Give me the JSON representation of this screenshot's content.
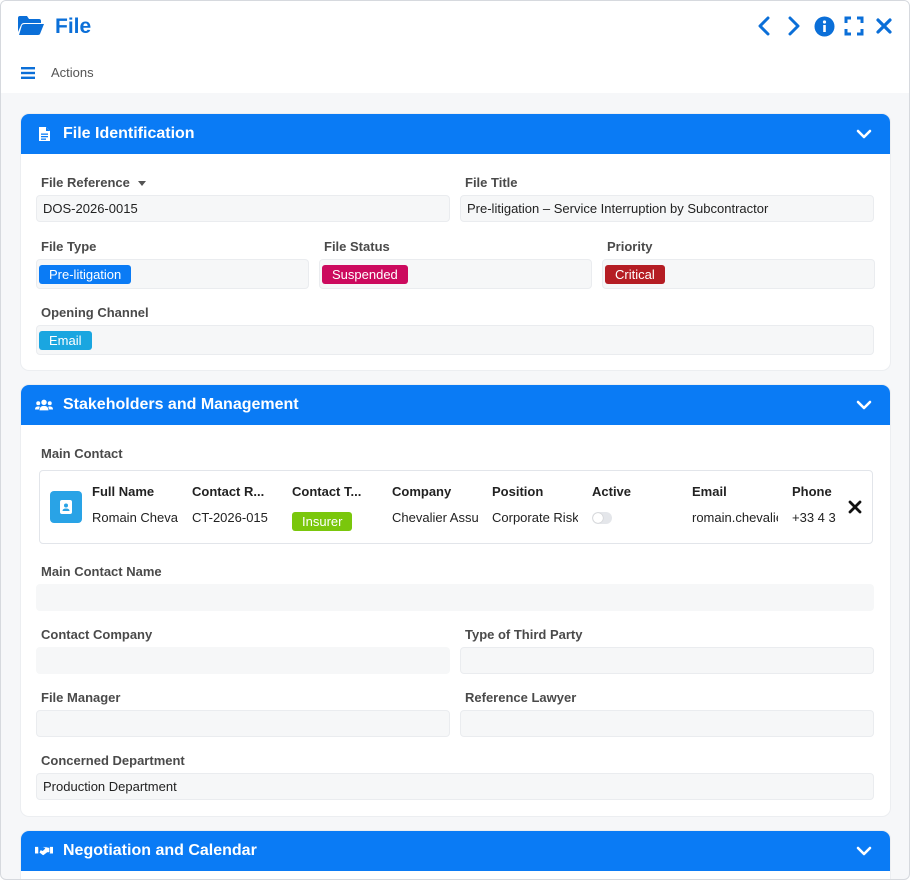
{
  "window": {
    "title": "File",
    "actions_label": "Actions"
  },
  "sections": {
    "identification": {
      "title": "File Identification",
      "file_reference_label": "File Reference",
      "file_reference_value": "DOS-2026-0015",
      "file_title_label": "File Title",
      "file_title_value": "Pre-litigation – Service Interruption by Subcontractor",
      "file_type_label": "File Type",
      "file_type_value": "Pre-litigation",
      "file_status_label": "File Status",
      "file_status_value": "Suspended",
      "priority_label": "Priority",
      "priority_value": "Critical",
      "opening_channel_label": "Opening Channel",
      "opening_channel_value": "Email"
    },
    "stakeholders": {
      "title": "Stakeholders and Management",
      "main_contact_label": "Main Contact",
      "contact_columns": [
        "Full Name",
        "Contact R...",
        "Contact T...",
        "Company",
        "Position",
        "Active",
        "Email",
        "Phone"
      ],
      "contact_row": {
        "full_name": "Romain Chevalier",
        "contact_ref": "CT-2026-015",
        "contact_type": "Insurer",
        "company": "Chevalier Assurances",
        "position": "Corporate Risk Manager",
        "email": "romain.chevalier@",
        "phone": "+33 4 3"
      },
      "main_contact_name_label": "Main Contact Name",
      "contact_company_label": "Contact Company",
      "third_party_label": "Type of Third Party",
      "file_manager_label": "File Manager",
      "reference_lawyer_label": "Reference Lawyer",
      "concerned_department_label": "Concerned Department",
      "concerned_department_value": "Production Department"
    },
    "negotiation": {
      "title": "Negotiation and Calendar"
    }
  },
  "colors": {
    "accent": "#0a7bf5",
    "title_blue": "#0b6fd8",
    "pill_pre_litigation": "#0a7bf5",
    "pill_suspended": "#cc0a5e",
    "pill_critical": "#b51d24",
    "pill_email": "#1aa6e0",
    "pill_insurer": "#7ac70c"
  },
  "icons": {
    "title": "folder-open-icon",
    "nav_prev": "chevron-left-icon",
    "nav_next": "chevron-right-icon",
    "info": "info-icon",
    "fullscreen": "expand-icon",
    "close": "close-icon",
    "menu": "hamburger-icon"
  }
}
